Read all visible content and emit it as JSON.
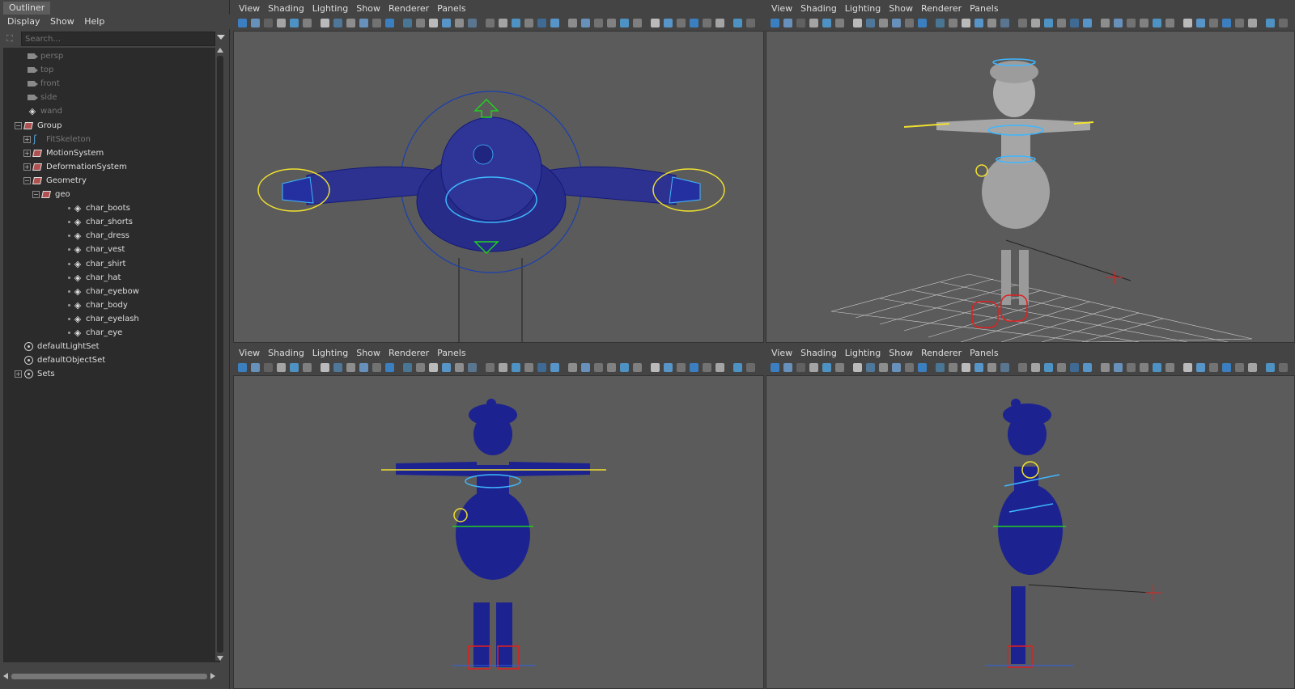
{
  "outliner": {
    "title": "Outliner",
    "menu": [
      "Display",
      "Show",
      "Help"
    ],
    "search_placeholder": "Search...",
    "tree": [
      {
        "label": "persp",
        "icon": "camera-icon",
        "dim": true
      },
      {
        "label": "top",
        "icon": "camera-icon",
        "dim": true
      },
      {
        "label": "front",
        "icon": "camera-icon",
        "dim": true
      },
      {
        "label": "side",
        "icon": "camera-icon",
        "dim": true
      },
      {
        "label": "wand",
        "icon": "mesh-icon",
        "dim": true
      },
      {
        "label": "Group",
        "icon": "group-icon",
        "expander": "−"
      },
      {
        "label": "FitSkeleton",
        "icon": "skeleton-icon",
        "expander": "+",
        "dim": true
      },
      {
        "label": "MotionSystem",
        "icon": "group-icon",
        "expander": "+"
      },
      {
        "label": "DeformationSystem",
        "icon": "group-icon",
        "expander": "+"
      },
      {
        "label": "Geometry",
        "icon": "group-icon",
        "expander": "−"
      },
      {
        "label": "geo",
        "icon": "group-icon",
        "expander": "−"
      },
      {
        "label": "char_boots",
        "icon": "mesh-icon"
      },
      {
        "label": "char_shorts",
        "icon": "mesh-icon"
      },
      {
        "label": "char_dress",
        "icon": "mesh-icon"
      },
      {
        "label": "char_vest",
        "icon": "mesh-icon"
      },
      {
        "label": "char_shirt",
        "icon": "mesh-icon"
      },
      {
        "label": "char_hat",
        "icon": "mesh-icon"
      },
      {
        "label": "char_eyebow",
        "icon": "mesh-icon"
      },
      {
        "label": "char_body",
        "icon": "mesh-icon"
      },
      {
        "label": "char_eyelash",
        "icon": "mesh-icon"
      },
      {
        "label": "char_eye",
        "icon": "mesh-icon"
      },
      {
        "label": "defaultLightSet",
        "icon": "set-icon"
      },
      {
        "label": "defaultObjectSet",
        "icon": "set-icon"
      },
      {
        "label": "Sets",
        "icon": "set-icon",
        "expander": "+"
      }
    ]
  },
  "viewport_menu": [
    "View",
    "Shading",
    "Lighting",
    "Show",
    "Renderer",
    "Panels"
  ],
  "viewports": [
    {
      "id": "top",
      "camera": "top"
    },
    {
      "id": "persp",
      "camera": "persp"
    },
    {
      "id": "front",
      "camera": "front"
    },
    {
      "id": "side",
      "camera": "side"
    }
  ],
  "colors": {
    "mesh_wireframe": "#1a1f8a",
    "ctrl_cyan": "#3fb7ff",
    "ctrl_yellow": "#f0e030",
    "ctrl_red": "#e02020",
    "ctrl_green": "#20d020",
    "highlight_blue": "#2f9be0"
  }
}
